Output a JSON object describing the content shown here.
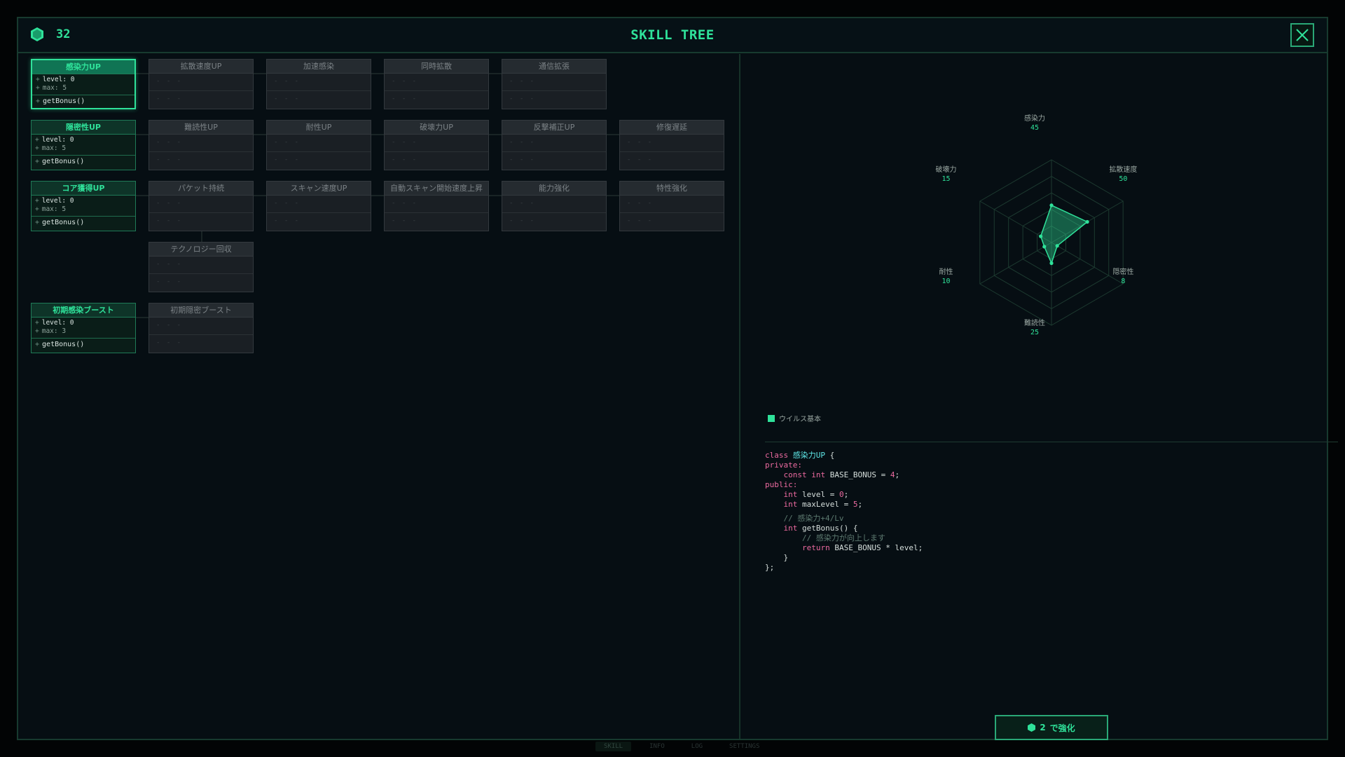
{
  "header": {
    "currency_value": "32",
    "currency_icon": "hex-icon",
    "title": "SKILL TREE",
    "close_icon": "close-icon"
  },
  "colors": {
    "accent": "#2fe29a",
    "panel": "#060e13",
    "border": "#173a2f",
    "locked_node": "#1a1f24"
  },
  "tree": {
    "rows": [
      {
        "nodes": [
          {
            "label": "感染力UP",
            "state": "active",
            "selected": true,
            "level": "level: 0",
            "max": "max: 5",
            "method": "getBonus()"
          },
          {
            "label": "拡散速度UP",
            "state": "locked"
          },
          {
            "label": "加速感染",
            "state": "locked"
          },
          {
            "label": "同時拡散",
            "state": "locked"
          },
          {
            "label": "通信拡張",
            "state": "locked"
          }
        ]
      },
      {
        "nodes": [
          {
            "label": "隠密性UP",
            "state": "active",
            "level": "level: 0",
            "max": "max: 5",
            "method": "getBonus()"
          },
          {
            "label": "難読性UP",
            "state": "locked"
          },
          {
            "label": "耐性UP",
            "state": "locked"
          },
          {
            "label": "破壊力UP",
            "state": "locked"
          },
          {
            "label": "反撃補正UP",
            "state": "locked"
          },
          {
            "label": "修復遅延",
            "state": "locked"
          }
        ]
      },
      {
        "nodes": [
          {
            "label": "コア獲得UP",
            "state": "active",
            "level": "level: 0",
            "max": "max: 5",
            "method": "getBonus()"
          },
          {
            "label": "パケット持続",
            "state": "locked"
          },
          {
            "label": "スキャン速度UP",
            "state": "locked"
          },
          {
            "label": "自動スキャン開始速度上昇",
            "state": "locked"
          },
          {
            "label": "能力強化",
            "state": "locked"
          },
          {
            "label": "特性強化",
            "state": "locked"
          }
        ]
      },
      {
        "nodes": [
          {
            "label": "テクノロジー回収",
            "state": "locked"
          }
        ]
      },
      {
        "nodes": [
          {
            "label": "初期感染ブースト",
            "state": "active",
            "level": "level: 0",
            "max": "max: 3",
            "method": "getBonus()"
          },
          {
            "label": "初期隠密ブースト",
            "state": "locked"
          }
        ]
      }
    ],
    "placeholder_dashes": "- - -"
  },
  "chart_data": {
    "type": "radar",
    "axes": [
      "感染力",
      "拡散速度",
      "隠密性",
      "難読性",
      "耐性",
      "破壊力"
    ],
    "values": [
      45,
      50,
      8,
      25,
      10,
      15
    ],
    "rmax": 100,
    "series": [
      {
        "name": "ウイルス基本",
        "values": [
          45,
          50,
          8,
          25,
          10,
          15
        ]
      }
    ],
    "legend": "bottom-left"
  },
  "radar_labels": [
    {
      "name": "感染力",
      "value": "45"
    },
    {
      "name": "拡散速度",
      "value": "50"
    },
    {
      "name": "隠密性",
      "value": "8"
    },
    {
      "name": "難読性",
      "value": "25"
    },
    {
      "name": "耐性",
      "value": "10"
    },
    {
      "name": "破壊力",
      "value": "15"
    }
  ],
  "legend": {
    "label": "ウイルス基本"
  },
  "code": {
    "line1_kw": "class ",
    "line1_name": "感染力UP",
    "line1_end": " {",
    "line2": "private:",
    "line3_indent": "    ",
    "line3_a": "const int",
    "line3_b": " BASE_BONUS = ",
    "line3_num": "4",
    "line3_end": ";",
    "line4": "public:",
    "line5_indent": "    ",
    "line5_a": "int",
    "line5_b": " level = ",
    "line5_num": "0",
    "line5_end": ";",
    "line6_indent": "    ",
    "line6_a": "int",
    "line6_b": " maxLevel = ",
    "line6_num": "5",
    "line6_end": ";",
    "line7": "    // 感染力+4/Lv",
    "line8_indent": "    ",
    "line8_a": "int",
    "line8_b": " getBonus() {",
    "line9": "        // 感染力が向上します",
    "line10_indent": "        ",
    "line10_a": "return",
    "line10_b": " BASE_BONUS * level;",
    "line11": "    }",
    "line12": "};"
  },
  "upgrade_button": {
    "cost": "2",
    "label": "で強化"
  },
  "footer_tabs": [
    "SKILL",
    "INFO",
    "LOG",
    "SETTINGS"
  ]
}
